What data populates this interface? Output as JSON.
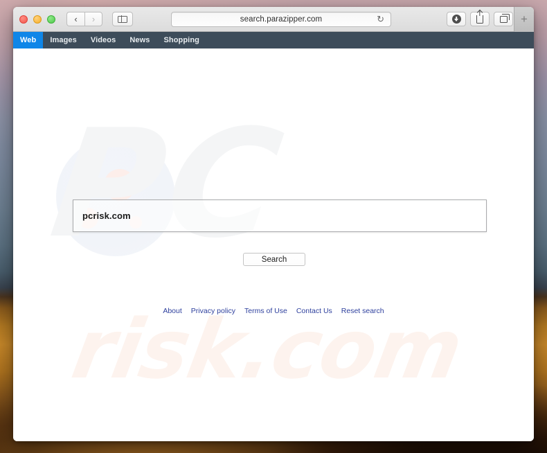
{
  "desktop": {
    "wallpaper_name": "desert-dunes-wallpaper"
  },
  "browser": {
    "traffic_lights": {
      "close_label": "",
      "minimize_label": "",
      "maximize_label": ""
    },
    "nav": {
      "back_glyph": "‹",
      "forward_glyph": "›"
    },
    "sidebar_button_name": "show-sidebar",
    "address_bar": {
      "url": "search.parazipper.com",
      "reload_glyph": "↻"
    },
    "toolbar_right": {
      "download_icon": "download-icon",
      "share_icon": "share-icon",
      "tabs_icon": "tab-overview-icon"
    },
    "new_tab_label": "+"
  },
  "site_nav": {
    "items": [
      {
        "label": "Web",
        "active": true
      },
      {
        "label": "Images",
        "active": false
      },
      {
        "label": "Videos",
        "active": false
      },
      {
        "label": "News",
        "active": false
      },
      {
        "label": "Shopping",
        "active": false
      }
    ]
  },
  "search": {
    "query_value": "pcrisk.com",
    "placeholder": "",
    "button_label": "Search"
  },
  "watermark": {
    "top_text": "PC",
    "bottom_text": "risk.com"
  },
  "footer": {
    "links": [
      {
        "label": "About"
      },
      {
        "label": "Privacy policy"
      },
      {
        "label": "Terms of Use"
      },
      {
        "label": "Contact Us"
      },
      {
        "label": "Reset search"
      }
    ]
  },
  "colors": {
    "nav_bar_bg": "#3d4c5a",
    "nav_active_bg": "#0f86e8",
    "link_blue": "#2d3f9d",
    "watermark_gray": "#f4f5f6",
    "watermark_pink": "#fdf3ee"
  }
}
